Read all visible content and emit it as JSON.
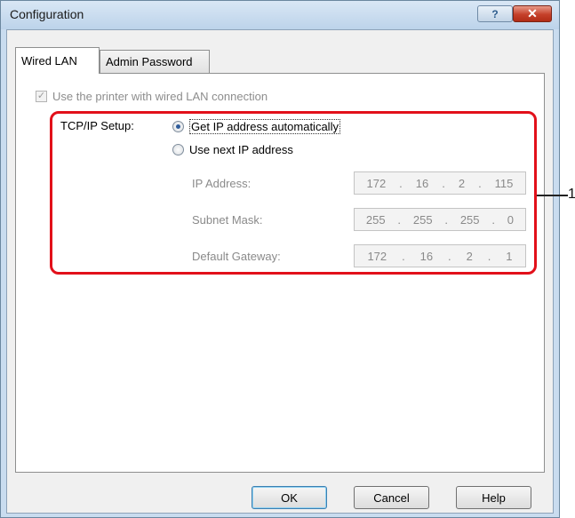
{
  "window": {
    "title": "Configuration",
    "help_glyph": "?",
    "close_glyph": "✕"
  },
  "tabs": [
    {
      "label": "Wired LAN",
      "active": true
    },
    {
      "label": "Admin Password",
      "active": false
    }
  ],
  "wired_lan": {
    "use_printer_checkbox": {
      "label": "Use the printer with wired LAN connection",
      "checked": true,
      "enabled": false
    },
    "tcpip_label": "TCP/IP Setup:",
    "radio_auto": {
      "label": "Get IP address automatically",
      "selected": true
    },
    "radio_manual": {
      "label": "Use next IP address",
      "selected": false
    },
    "fields": [
      {
        "label": "IP Address:",
        "octets": [
          "172",
          "16",
          "2",
          "115"
        ]
      },
      {
        "label": "Subnet Mask:",
        "octets": [
          "255",
          "255",
          "255",
          "0"
        ]
      },
      {
        "label": "Default Gateway:",
        "octets": [
          "172",
          "16",
          "2",
          "1"
        ]
      }
    ]
  },
  "callout": {
    "number": "1",
    "color": "#e2101a"
  },
  "buttons": {
    "ok": "OK",
    "cancel": "Cancel",
    "help": "Help"
  }
}
